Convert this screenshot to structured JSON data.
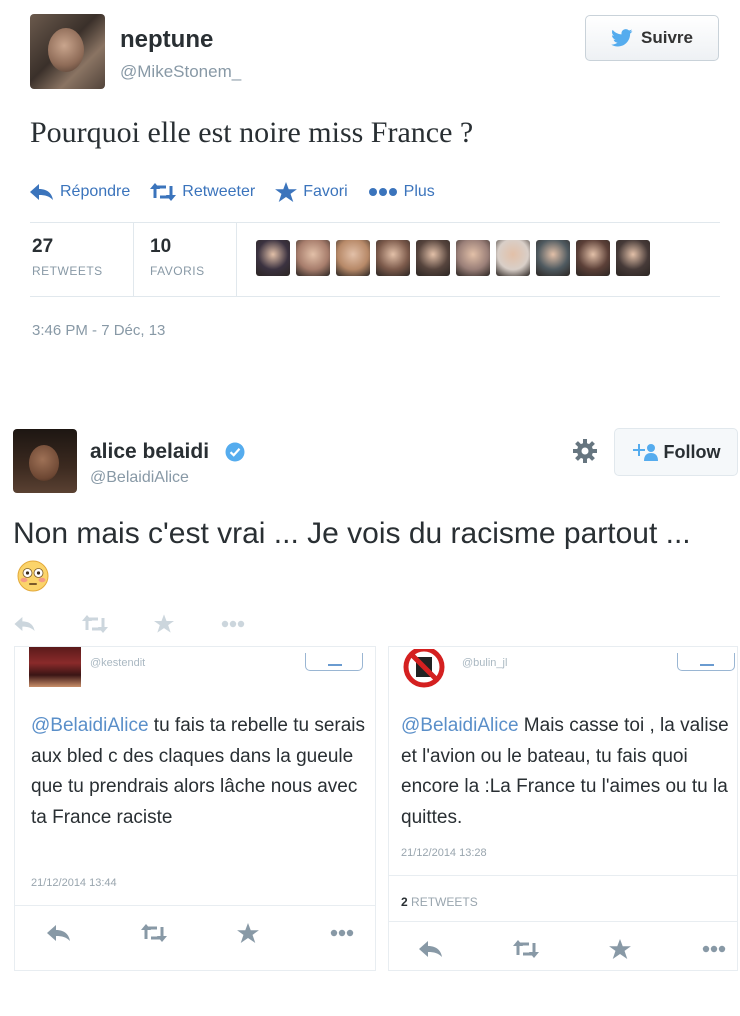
{
  "tweet1": {
    "name": "neptune",
    "handle": "@MikeStonem_",
    "follow_label": "Suivre",
    "text": "Pourquoi elle est noire miss France ?",
    "actions": {
      "reply": "Répondre",
      "retweet": "Retweeter",
      "favorite": "Favori",
      "more": "Plus"
    },
    "stats": {
      "retweets_count": "27",
      "retweets_label": "RETWEETS",
      "favorites_count": "10",
      "favorites_label": "FAVORIS"
    },
    "timestamp": "3:46 PM - 7 Déc, 13",
    "favoriter_avatar_colors": [
      "#3b3240",
      "#a77d6c",
      "#b78968",
      "#7c5a4b",
      "#56443d",
      "#9a7f78",
      "#d9cfc8",
      "#4f5a60",
      "#5c4038",
      "#463a38"
    ]
  },
  "tweet2": {
    "name": "alice belaidi",
    "handle": "@BelaidiAlice",
    "follow_label": "Follow",
    "text": "Non mais c'est vrai ... Je vois du racisme partout ...",
    "emoji": "flushed-face"
  },
  "replies": [
    {
      "handle": "@kestendit",
      "mention": "@BelaidiAlice",
      "text": " tu fais ta rebelle tu serais aux bled c des claques dans la gueule que tu prendrais alors lâche nous avec ta France raciste",
      "timestamp": "21/12/2014 13:44"
    },
    {
      "handle": "@bulin_jl",
      "mention": "@BelaidiAlice",
      "text": " Mais casse toi , la valise et l'avion ou le bateau, tu fais quoi encore la :La France tu l'aimes ou tu la quittes.",
      "timestamp": "21/12/2014 13:28",
      "retweets_count": "2",
      "retweets_label": "RETWEETS"
    }
  ],
  "colors": {
    "link_blue": "#3b74bc",
    "muted_gray": "#8899a6",
    "verified_blue": "#55acee"
  }
}
